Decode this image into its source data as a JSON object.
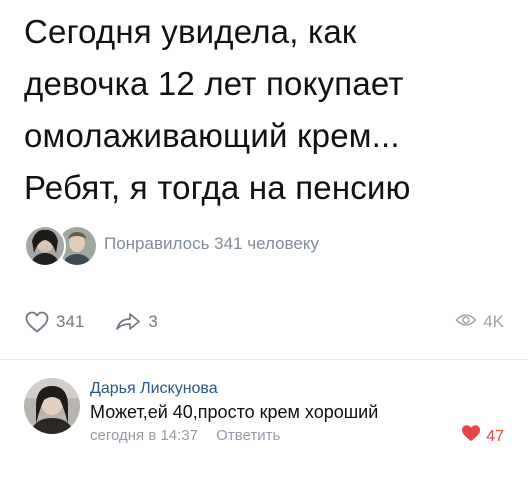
{
  "post": {
    "lines": [
      "Сегодня увидела, как",
      "девочка 12 лет покупает",
      "омолаживающий крем...",
      "Ребят, я тогда на пенсию"
    ],
    "liked_by_text": "Понравилось 341 человеку"
  },
  "actions": {
    "likes": "341",
    "shares": "3",
    "views": "4K"
  },
  "comment": {
    "author": "Дарья Лискунова",
    "text": "Может,ей 40,просто крем хороший",
    "time": "сегодня в 14:37",
    "reply_label": "Ответить",
    "likes": "47"
  },
  "colors": {
    "link": "#2a5885",
    "secondary": "#818c99",
    "liked_heart": "#e64646"
  },
  "icons": {
    "like": "heart-outline-icon",
    "share": "share-arrow-icon",
    "views": "eye-icon",
    "comment_like": "heart-filled-icon"
  }
}
